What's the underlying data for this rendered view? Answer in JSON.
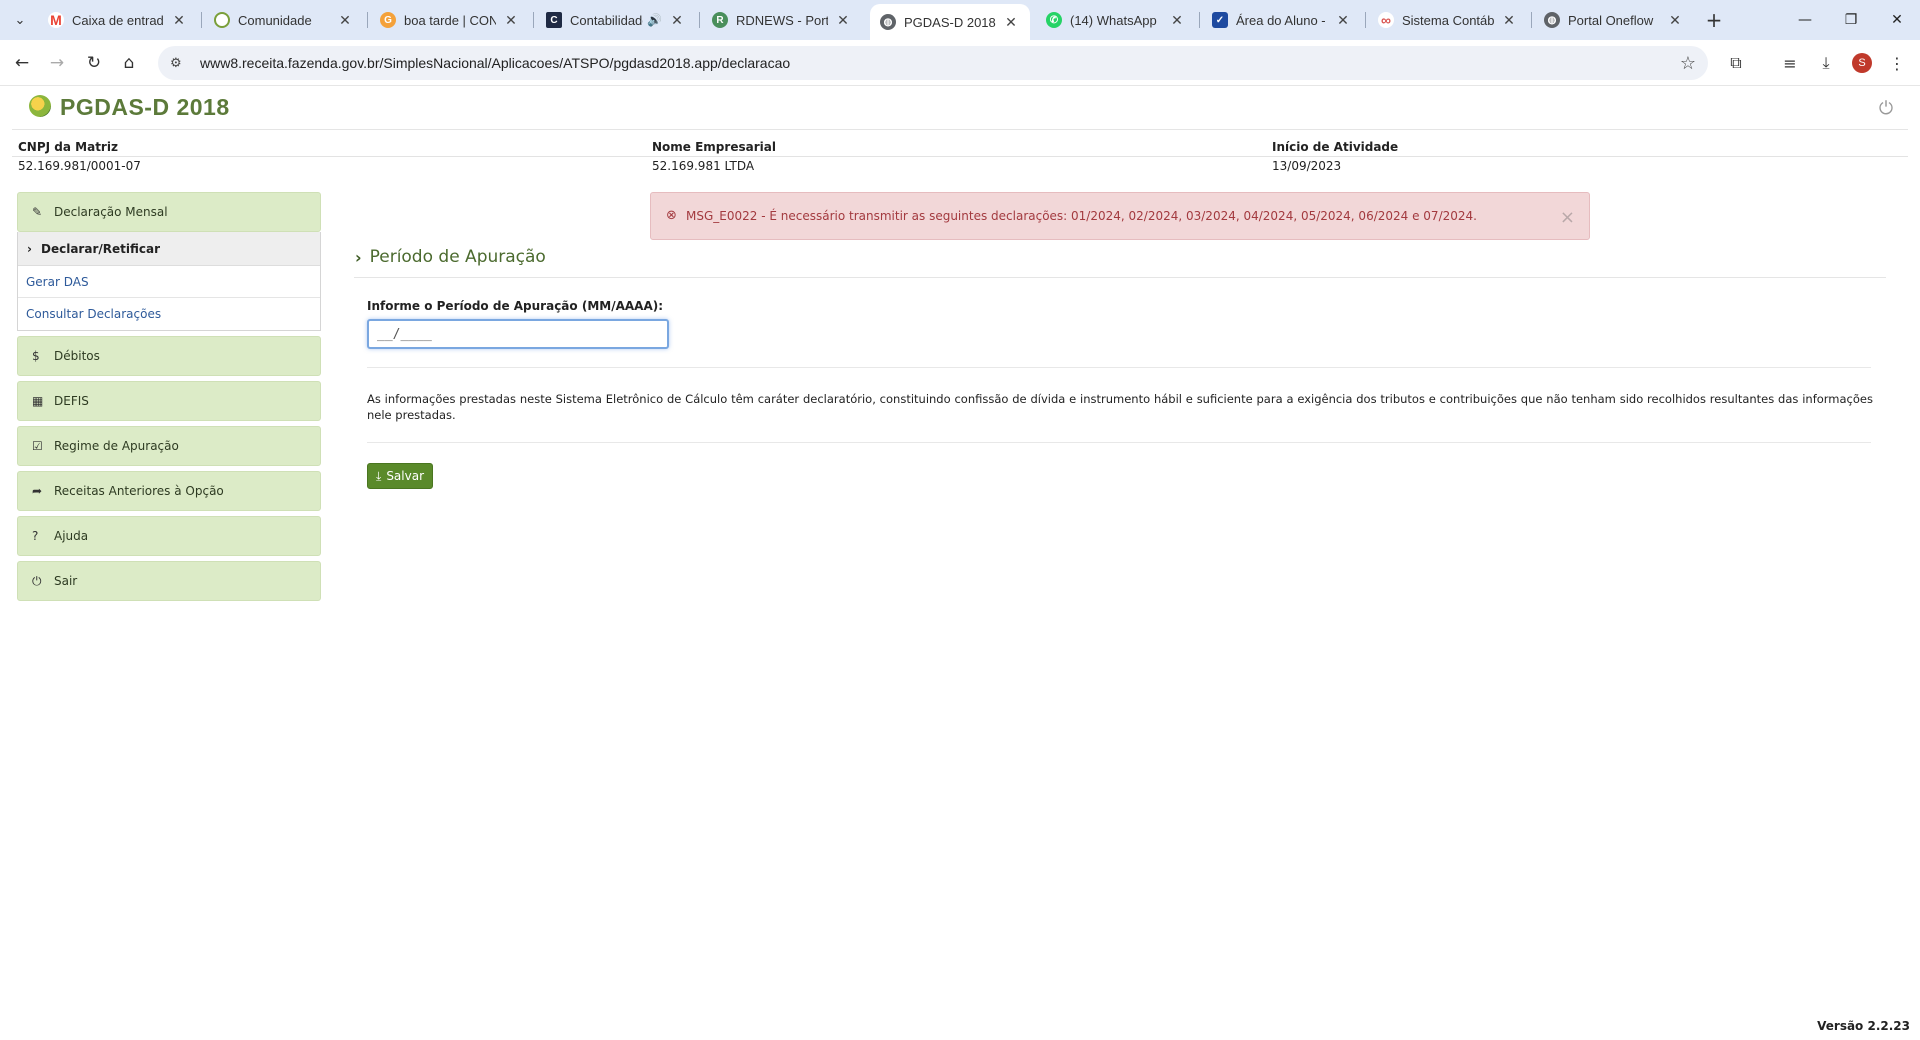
{
  "browser": {
    "tabs": [
      {
        "title": "Caixa de entrada (",
        "icon": "gmail-icon",
        "color": "#ea4335"
      },
      {
        "title": "Comunidade",
        "icon": "community-icon",
        "color": "#7a9f3a"
      },
      {
        "title": "boa tarde | CONT",
        "icon": "google-icon",
        "color": "#f4a13a"
      },
      {
        "title": "Contabilidade",
        "icon": "contabilidade-icon",
        "color": "#1f2a44"
      },
      {
        "title": "RDNEWS - Portal",
        "icon": "rdnews-icon",
        "color": "#4a8f5c"
      },
      {
        "title": "PGDAS-D 2018",
        "icon": "globe-icon",
        "color": "#5f6368"
      },
      {
        "title": "(14) WhatsApp",
        "icon": "whatsapp-icon",
        "color": "#25d366"
      },
      {
        "title": "Área do Aluno - E",
        "icon": "shield-icon",
        "color": "#1e4aa0"
      },
      {
        "title": "Sistema Contábil",
        "icon": "infinity-icon",
        "color": "#d9534f"
      },
      {
        "title": "Portal Oneflow",
        "icon": "globe-icon",
        "color": "#5f6368"
      }
    ],
    "url": "www8.receita.fazenda.gov.br/SimplesNacional/Aplicacoes/ATSPO/pgdasd2018.app/declaracao",
    "profile_initial": "S"
  },
  "app": {
    "title": "PGDAS-D 2018",
    "version": "Versão 2.2.23"
  },
  "company": {
    "cnpj_label": "CNPJ da Matriz",
    "cnpj_value": "52.169.981/0001-07",
    "name_label": "Nome Empresarial",
    "name_value": "52.169.981 LTDA",
    "start_label": "Início de Atividade",
    "start_value": "13/09/2023"
  },
  "sidebar": {
    "declaracao_mensal": "Declaração Mensal",
    "declarar_retificar": "Declarar/Retificar",
    "gerar_das": "Gerar DAS",
    "consultar": "Consultar Declarações",
    "debitos": "Débitos",
    "defis": "DEFIS",
    "regime": "Regime de Apuração",
    "receitas": "Receitas Anteriores à Opção",
    "ajuda": "Ajuda",
    "sair": "Sair"
  },
  "alert": {
    "message": "MSG_E0022 - É necessário transmitir as seguintes declarações: 01/2024, 02/2024, 03/2024, 04/2024, 05/2024, 06/2024 e 07/2024."
  },
  "main": {
    "section_title": "Período de Apuração",
    "field_label": "Informe o Período de Apuração (MM/AAAA):",
    "field_placeholder": "__/____",
    "disclaimer": "As informações prestadas neste Sistema Eletrônico de Cálculo têm caráter declaratório, constituindo confissão de dívida e instrumento hábil e suficiente para a exigência dos tributos e contribuições que não tenham sido recolhidos resultantes das informações nele prestadas.",
    "save_label": "Salvar"
  },
  "colors": {
    "brand_green": "#5c7a3a",
    "sidebar_bg": "#dcebc7",
    "alert_bg": "#f2d7d8",
    "alert_text": "#a33a3f",
    "button_green": "#5a8a2a"
  }
}
